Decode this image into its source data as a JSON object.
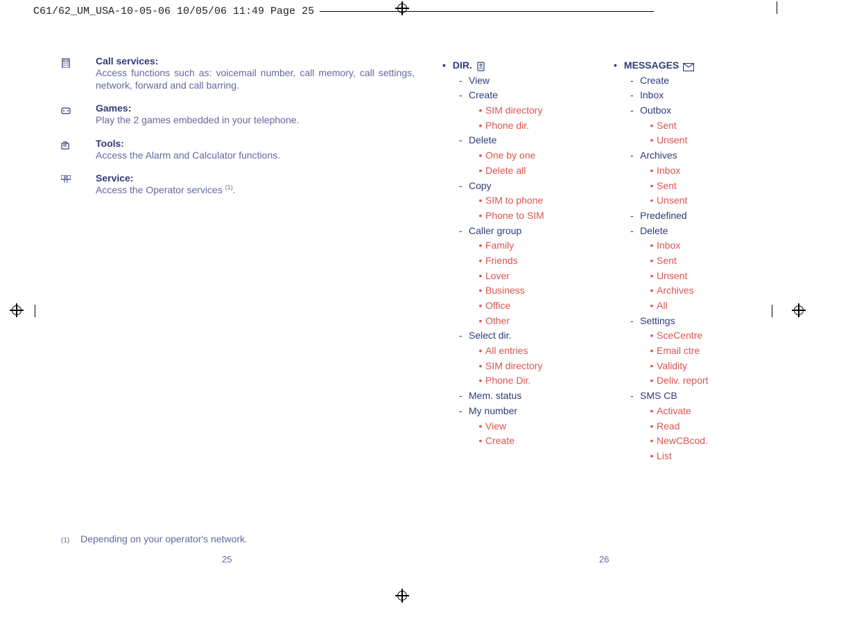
{
  "header": "C61/62_UM_USA-10-05-06  10/05/06  11:49  Page 25",
  "left_entries": [
    {
      "icon": "phone-ui-icon",
      "title": "Call services:",
      "desc": "Access functions such as: voicemail number, call memory, call settings, network, forward and call barring."
    },
    {
      "icon": "games-icon",
      "title": "Games:",
      "desc": "Play the 2 games embedded in your telephone."
    },
    {
      "icon": "tools-icon",
      "title": "Tools:",
      "desc": "Access the Alarm and Calculator functions."
    },
    {
      "icon": "service-icon",
      "title": "Service:",
      "desc": "Access the Operator services ",
      "sup": "(1)",
      "tail": "."
    }
  ],
  "footnote": {
    "marker": "(1)",
    "text": "Depending on your operator's network."
  },
  "page_left": "25",
  "page_right": "26",
  "dir": {
    "title": "DIR.",
    "items": [
      {
        "label": "View"
      },
      {
        "label": "Create",
        "children": [
          "SIM directory",
          "Phone dir."
        ]
      },
      {
        "label": "Delete",
        "children": [
          "One by one",
          "Delete all"
        ]
      },
      {
        "label": "Copy",
        "children": [
          "SIM to phone",
          "Phone to SIM"
        ]
      },
      {
        "label": "Caller group",
        "children": [
          "Family",
          "Friends",
          "Lover",
          "Business",
          "Office",
          "Other"
        ]
      },
      {
        "label": "Select dir.",
        "children": [
          "All entries",
          "SIM directory",
          "Phone Dir."
        ]
      },
      {
        "label": "Mem. status"
      },
      {
        "label": "My number",
        "children": [
          "View",
          "Create"
        ]
      }
    ]
  },
  "messages": {
    "title": "MESSAGES",
    "items": [
      {
        "label": "Create"
      },
      {
        "label": "Inbox"
      },
      {
        "label": "Outbox",
        "children": [
          "Sent",
          "Unsent"
        ]
      },
      {
        "label": "Archives",
        "children": [
          "Inbox",
          "Sent",
          "Unsent"
        ]
      },
      {
        "label": "Predefined"
      },
      {
        "label": "Delete",
        "children": [
          "Inbox",
          "Sent",
          "Unsent",
          "Archives",
          "All"
        ]
      },
      {
        "label": "Settings",
        "children": [
          "SceCentre",
          "Email ctre",
          "Validity",
          "Deliv. report"
        ]
      },
      {
        "label": "SMS CB",
        "children": [
          "Activate",
          "Read",
          "NewCBcod.",
          "List"
        ]
      }
    ]
  }
}
